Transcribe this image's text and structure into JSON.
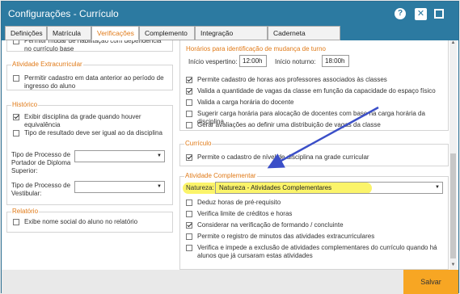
{
  "window": {
    "title": "Configurações - Currículo",
    "help": "?",
    "close": "✕"
  },
  "tabs": [
    {
      "label": "Definições",
      "active": false
    },
    {
      "label": "Matrícula",
      "active": false
    },
    {
      "label": "Verificações",
      "active": true
    },
    {
      "label": "Complemento",
      "active": false
    },
    {
      "label": "Integração SAGRES",
      "active": false
    },
    {
      "label": "Caderneta Eletrônica",
      "active": false
    }
  ],
  "left": {
    "top_partial": {
      "label": "Permitir mudar de habilitação com dependência no currículo base",
      "checked": false
    },
    "atividade_extracurricular": {
      "title": "Atividade Extracurricular",
      "options": [
        {
          "label": "Permitir cadastro em data anterior ao período de ingresso do aluno",
          "checked": false
        }
      ]
    },
    "historico": {
      "title": "Histórico",
      "options": [
        {
          "label": "Exibir disciplina da grade quando houver equivalência",
          "checked": true
        },
        {
          "label": "Tipo de resultado deve ser igual ao da disciplina",
          "checked": false
        }
      ],
      "fields": [
        {
          "label": "Tipo de Processo de Portador de Diploma Superior:",
          "value": ""
        },
        {
          "label": "Tipo de Processo de Vestibular:",
          "value": ""
        }
      ]
    },
    "relatorio": {
      "title": "Relatório",
      "options": [
        {
          "label": "Exibe nome social do aluno no relatório",
          "checked": false
        }
      ]
    }
  },
  "right": {
    "horarios": {
      "title": "Horários para identificação de mudança de turno",
      "vespertino_label": "Início vespertino:",
      "vespertino_value": "12:00h",
      "noturno_label": "Início noturno:",
      "noturno_value": "18:00h"
    },
    "options": [
      {
        "label": "Permite cadastro de horas aos professores associados às classes",
        "checked": true
      },
      {
        "label": "Valida a quantidade de vagas da classe em função da capacidade do espaço físico",
        "checked": true
      },
      {
        "label": "Valida a carga horária do docente",
        "checked": false
      },
      {
        "label": "Sugerir carga horária para alocação de docentes com base na carga horária da disciplina",
        "checked": false
      },
      {
        "label": "Gerar avaliações ao definir uma distribuição de vagas da classe",
        "checked": false
      }
    ],
    "curriculo": {
      "title": "Currículo",
      "options": [
        {
          "label": "Permite o cadastro de nível de disciplina na grade curricular",
          "checked": true
        }
      ]
    },
    "atividade_complementar": {
      "title": "Atividade Complementar",
      "natureza_label": "Natureza:",
      "natureza_value": "Natureza - Atividades Complementares",
      "options": [
        {
          "label": "Deduz horas de pré-requisito",
          "checked": false
        },
        {
          "label": "Verifica limite de créditos e horas",
          "checked": false
        },
        {
          "label": "Considerar na verificação de formando / concluinte",
          "checked": true
        },
        {
          "label": "Permite o registro de minutos das atividades extracurriculares",
          "checked": false
        },
        {
          "label": "Verifica e impede a exclusão de atividades complementares do currículo quando há alunos que já cursaram estas atividades",
          "checked": false
        }
      ]
    }
  },
  "footer": {
    "save_label": "Salvar"
  },
  "colors": {
    "titlebar": "#2c7aa1",
    "accent": "#e07a18",
    "save": "#f7a623",
    "highlight": "#fbf46a",
    "arrow": "#3b4fc8"
  }
}
